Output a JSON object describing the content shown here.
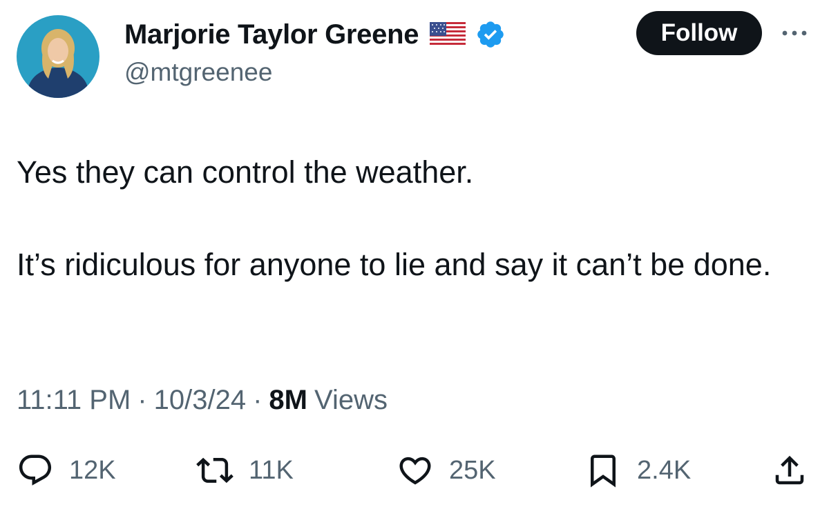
{
  "author": {
    "display_name": "Marjorie Taylor Greene",
    "handle": "@mtgreenee",
    "badges": [
      "us-flag-icon",
      "verified-icon"
    ],
    "verified_color": "#1d9bf0"
  },
  "header": {
    "follow_label": "Follow",
    "more_icon": "more-icon"
  },
  "tweet": {
    "paragraphs": [
      "Yes they can control the weather.",
      "It’s ridiculous for anyone to lie and say it can’t be done."
    ]
  },
  "meta": {
    "time": "11:11 PM",
    "separator": "·",
    "date": "10/3/24",
    "views_count": "8M",
    "views_label": "Views"
  },
  "actions": {
    "reply": {
      "icon": "reply-icon",
      "count": "12K"
    },
    "retweet": {
      "icon": "retweet-icon",
      "count": "11K"
    },
    "like": {
      "icon": "heart-icon",
      "count": "25K"
    },
    "bookmark": {
      "icon": "bookmark-icon",
      "count": "2.4K"
    },
    "share": {
      "icon": "share-icon"
    }
  },
  "colors": {
    "text": "#0f1419",
    "secondary": "#536471",
    "follow_bg": "#0f1419",
    "background": "#ffffff"
  }
}
